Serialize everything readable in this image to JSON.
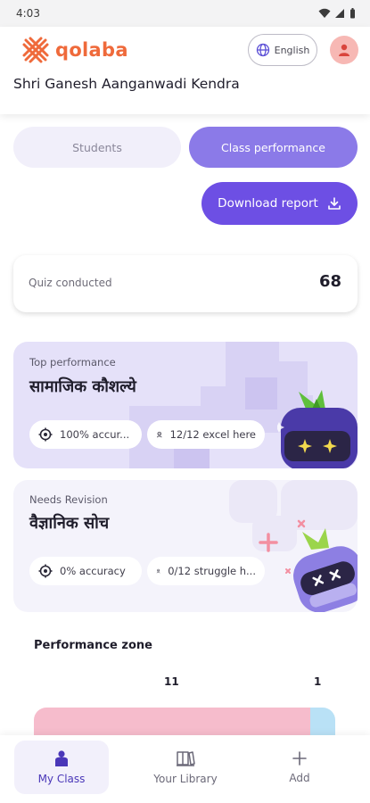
{
  "status_bar": {
    "time": "4:03"
  },
  "header": {
    "brand": "qolaba",
    "language_button": "English",
    "school_name": "Shri Ganesh Aanganwadi Kendra"
  },
  "tabs": [
    {
      "label": "Students",
      "selected": false
    },
    {
      "label": "Class performance",
      "selected": true
    }
  ],
  "download_button": "Download report",
  "quiz_card": {
    "label": "Quiz conducted",
    "value": "68"
  },
  "top_performance": {
    "kicker": "Top performance",
    "subject": "सामाजिक कौशल्ये",
    "accuracy_pill": "100% accur...",
    "excel_pill": "12/12 excel here"
  },
  "needs_revision": {
    "kicker": "Needs Revision",
    "subject": "वैज्ञानिक सोच",
    "accuracy_pill": "0% accuracy",
    "struggle_pill": "0/12 struggle h..."
  },
  "performance_zone": {
    "title": "Performance zone",
    "counts": [
      "11",
      "1"
    ],
    "segments": [
      {
        "value": 11,
        "color": "#f6bccc"
      },
      {
        "value": 1,
        "color": "#b9e1f6"
      }
    ]
  },
  "bottom_nav": [
    {
      "label": "My Class",
      "icon": "my-class-icon",
      "active": true
    },
    {
      "label": "Your Library",
      "icon": "library-icon",
      "active": false
    },
    {
      "label": "Add",
      "icon": "add-icon",
      "active": false
    }
  ],
  "colors": {
    "brand_orange": "#ef6a3b",
    "primary_purple": "#6d4fe4",
    "selected_tab": "#8b7ae8",
    "top_card_bg": "#e5e1f9",
    "revision_card_bg": "#f4f3fb"
  }
}
